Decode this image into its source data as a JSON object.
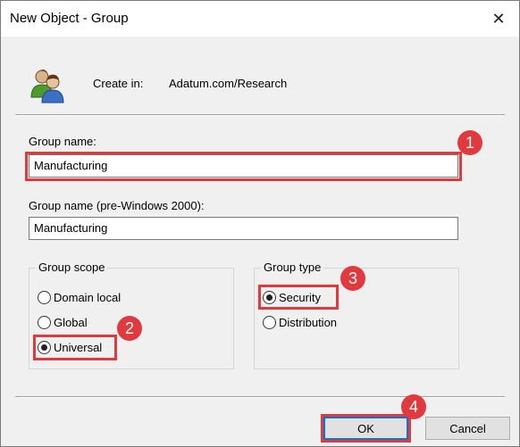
{
  "window": {
    "title": "New Object - Group",
    "close_glyph": "✕"
  },
  "header": {
    "icon": "users-group-icon",
    "create_in_label": "Create in:",
    "create_in_value": "Adatum.com/Research"
  },
  "form": {
    "group_name_label": "Group name:",
    "group_name_value": "Manufacturing",
    "pre2000_label": "Group name (pre-Windows 2000):",
    "pre2000_value": "Manufacturing"
  },
  "group_scope": {
    "title": "Group scope",
    "options": [
      {
        "label": "Domain local",
        "selected": false
      },
      {
        "label": "Global",
        "selected": false
      },
      {
        "label": "Universal",
        "selected": true
      }
    ]
  },
  "group_type": {
    "title": "Group type",
    "options": [
      {
        "label": "Security",
        "selected": true
      },
      {
        "label": "Distribution",
        "selected": false
      }
    ]
  },
  "buttons": {
    "ok": "OK",
    "cancel": "Cancel"
  },
  "annotations": {
    "step1": "1",
    "step2": "2",
    "step3": "3",
    "step4": "4",
    "color": "#e0393e"
  }
}
